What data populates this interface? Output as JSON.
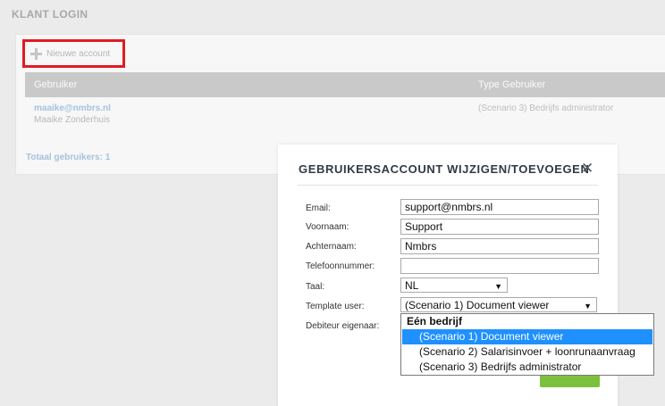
{
  "page": {
    "title": "KLANT LOGIN"
  },
  "toolbar": {
    "new_account_label": "Nieuwe account"
  },
  "table": {
    "headers": [
      "Gebruiker",
      "Type Gebruiker"
    ],
    "rows": [
      {
        "email": "maaike@nmbrs.nl",
        "name": "Maaike Zonderhuis",
        "type": "(Scenario 3) Bedrijfs administrator"
      }
    ],
    "total_label": "Totaal gebruikers: 1"
  },
  "modal": {
    "title": "GEBRUIKERSACCOUNT WIJZIGEN/TOEVOEGEN",
    "close_glyph": "✕",
    "labels": {
      "email": "Email:",
      "firstname": "Voornaam:",
      "lastname": "Achternaam:",
      "phone": "Telefoonnummer:",
      "language": "Taal:",
      "template": "Template user:",
      "debtor": "Debiteur eigenaar:"
    },
    "values": {
      "email": "support@nmbrs.nl",
      "firstname": "Support",
      "lastname": "Nmbrs",
      "phone": "",
      "language": "NL",
      "template": "(Scenario 1) Document viewer"
    }
  },
  "dropdown": {
    "group_label": "Eén bedrijf",
    "options": [
      "(Scenario 1) Document viewer",
      "(Scenario 2) Salarisinvoer + loonrunaanvraag",
      "(Scenario 3) Bedrijfs administrator"
    ],
    "selected_index": 0
  },
  "colors": {
    "highlight_border": "#e21b24",
    "link": "#a5c2dc",
    "header_bg": "#c9c9c9",
    "button_green": "#7cc13d",
    "selection": "#1e90ff"
  }
}
